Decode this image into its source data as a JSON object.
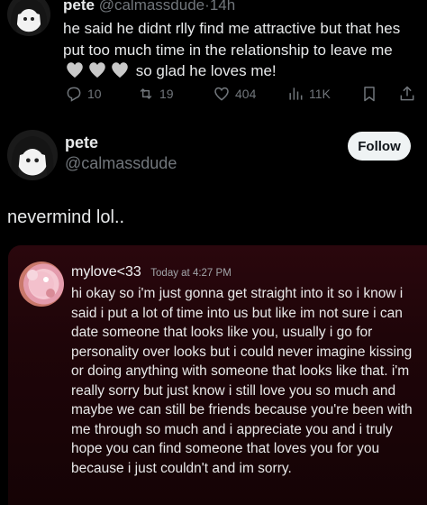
{
  "reply_tweet": {
    "display_name": "pete",
    "handle": "@calmassdude",
    "separator": "·",
    "time": "14h",
    "text_before": "he said he didnt rlly find me attractive but that hes put too much time in the relationship to leave me",
    "heart_emoji": [
      "🩶",
      "🩶",
      "🩶"
    ],
    "text_after": "so glad he loves me!",
    "actions": {
      "reply_count": "10",
      "retweet_count": "19",
      "like_count": "404",
      "views_count": "11K"
    }
  },
  "main_tweet": {
    "display_name": "pete",
    "handle": "@calmassdude",
    "follow_label": "Follow",
    "text": "nevermind lol.."
  },
  "dm_screenshot": {
    "sender": "mylove<33",
    "timestamp": "Today at 4:27 PM",
    "message": "hi okay so i'm just gonna get straight into it so i know i said i put a lot of time into us but like im not sure i can date someone that looks like you, usually i go for personality over looks but i could never imagine kissing or doing anything with someone that looks like that. i'm really sorry but just know i still love you so much and maybe we can still be friends because you're been with me through so much and i appreciate you and i truly hope you can find someone that loves you for you because i just couldn't and im sorry."
  },
  "colors": {
    "background": "#000000",
    "text": "#e7e9ea",
    "secondary": "#71767b",
    "follow_button": "#eff3f4",
    "dm_background": "#220609"
  }
}
